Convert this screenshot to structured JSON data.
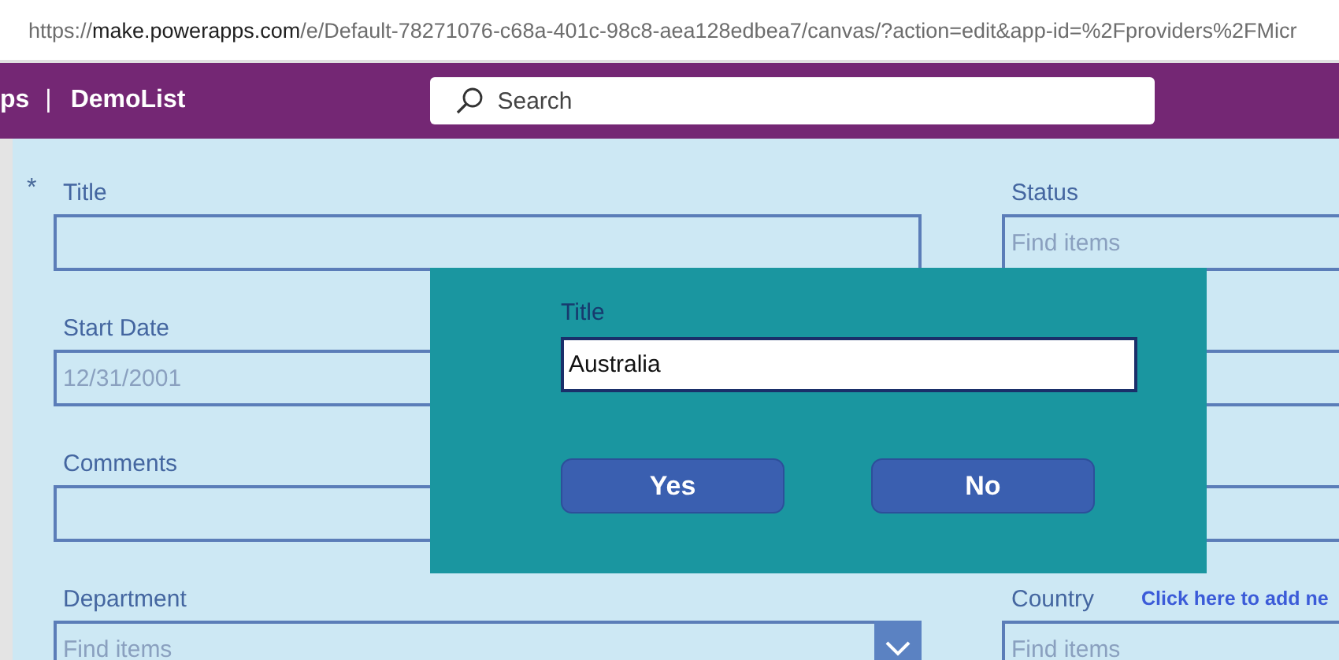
{
  "address_bar": {
    "scheme": "https://",
    "host": "make.powerapps.com",
    "path": "/e/Default-78271076-c68a-401c-98c8-aea128edbea7/canvas/?action=edit&app-id=%2Fproviders%2FMicr"
  },
  "header": {
    "app_prefix": "ps",
    "separator": "|",
    "app_name": "DemoList",
    "search": {
      "placeholder": "Search"
    }
  },
  "form": {
    "left": [
      {
        "label": "Title",
        "required_mark": "*",
        "kind": "text"
      },
      {
        "label": "Start Date",
        "kind": "text",
        "value": "12/31/2001",
        "disabled": true
      },
      {
        "label": "Comments",
        "kind": "text"
      },
      {
        "label": "Department",
        "kind": "combo",
        "placeholder": "Find items"
      }
    ],
    "right": [
      {
        "label": "Status",
        "kind": "combo",
        "placeholder": "Find items"
      },
      {
        "kind": "text"
      },
      {
        "kind": "text"
      },
      {
        "label": "Country",
        "kind": "combo",
        "placeholder": "Find items",
        "link": "Click here to add ne"
      }
    ]
  },
  "dialog": {
    "label": "Title",
    "value": "Australia",
    "buttons": [
      "Yes",
      "No"
    ]
  }
}
